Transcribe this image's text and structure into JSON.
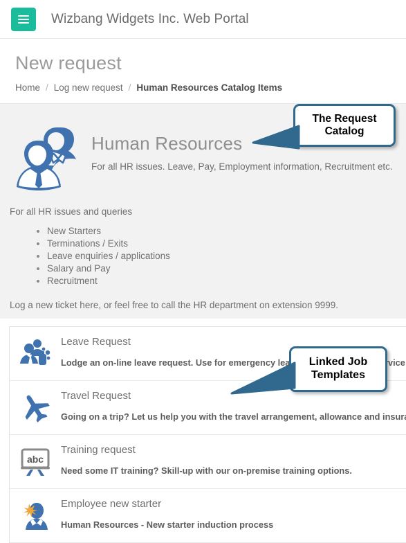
{
  "topbar": {
    "menu_icon": "hamburger-menu-icon",
    "brand": "Wizbang Widgets Inc. Web Portal",
    "accent_color": "#1abc9c"
  },
  "page": {
    "title": "New request",
    "breadcrumb": {
      "home": "Home",
      "sep": "/",
      "parent": "Log new request",
      "current": "Human Resources Catalog Items"
    }
  },
  "catalog": {
    "icon": "two-people-icon",
    "name": "Human Resources",
    "description": "For all HR issues. Leave, Pay, Employment information, Recruitment etc.",
    "intro": "For all HR issues and queries",
    "topics": [
      "New Starters",
      "Terminations / Exits",
      "Leave enquiries / applications",
      "Salary and Pay",
      "Recruitment"
    ],
    "footer": "Log a new ticket here, or feel free to call the HR department on extension 9999."
  },
  "items": [
    {
      "icon": "people-with-suitcase-icon",
      "title": "Leave Request",
      "desc": "Lodge an on-line leave request. Use for emergency leave or planned leave service"
    },
    {
      "icon": "airplane-icon",
      "title": "Travel Request",
      "desc": "Going on a trip? Let us help you with the travel arrangement, allowance and insurance"
    },
    {
      "icon": "abc-whiteboard-icon",
      "title": "Training request",
      "desc": "Need some IT training? Skill-up with our on-premise training options."
    },
    {
      "icon": "new-starter-person-icon",
      "title": "Employee new starter",
      "desc": "Human Resources - New starter induction process"
    }
  ],
  "callouts": {
    "request_catalog": "The Request Catalog",
    "linked_job_templates": "Linked Job Templates",
    "border_color": "#31688e"
  }
}
